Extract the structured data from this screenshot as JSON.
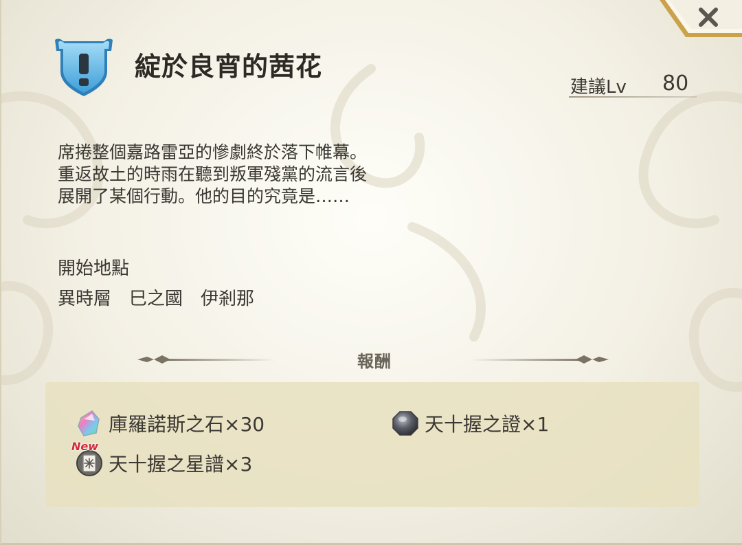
{
  "close_icon": "close-x-icon",
  "quest": {
    "icon": "shield-exclamation-icon",
    "title": "綻於良宵的茜花",
    "level_label": "建議Lv",
    "level_value": "80"
  },
  "description_lines": [
    "席捲整個嘉路雷亞的慘劇終於落下帷幕。",
    "重返故土的時雨在聽到叛軍殘黨的流言後",
    "展開了某個行動。他的目的究竟是……"
  ],
  "start": {
    "label": "開始地點",
    "location": "異時層　巳之國　伊剎那"
  },
  "rewards": {
    "title": "報酬",
    "items": [
      {
        "icon": "chronos-stone-icon",
        "label": "庫羅諾斯之石×30",
        "new": ""
      },
      {
        "icon": "dark-orb-icon",
        "label": "天十握之證×1",
        "new": ""
      },
      {
        "icon": "star-score-book-icon",
        "label": "天十握之星譜×3",
        "new": "New"
      }
    ]
  },
  "colors": {
    "shield_blue": "#57b6e8",
    "text": "#3b3833",
    "reward_box": "#e8e0c0",
    "new_tag": "#d02a3c"
  }
}
